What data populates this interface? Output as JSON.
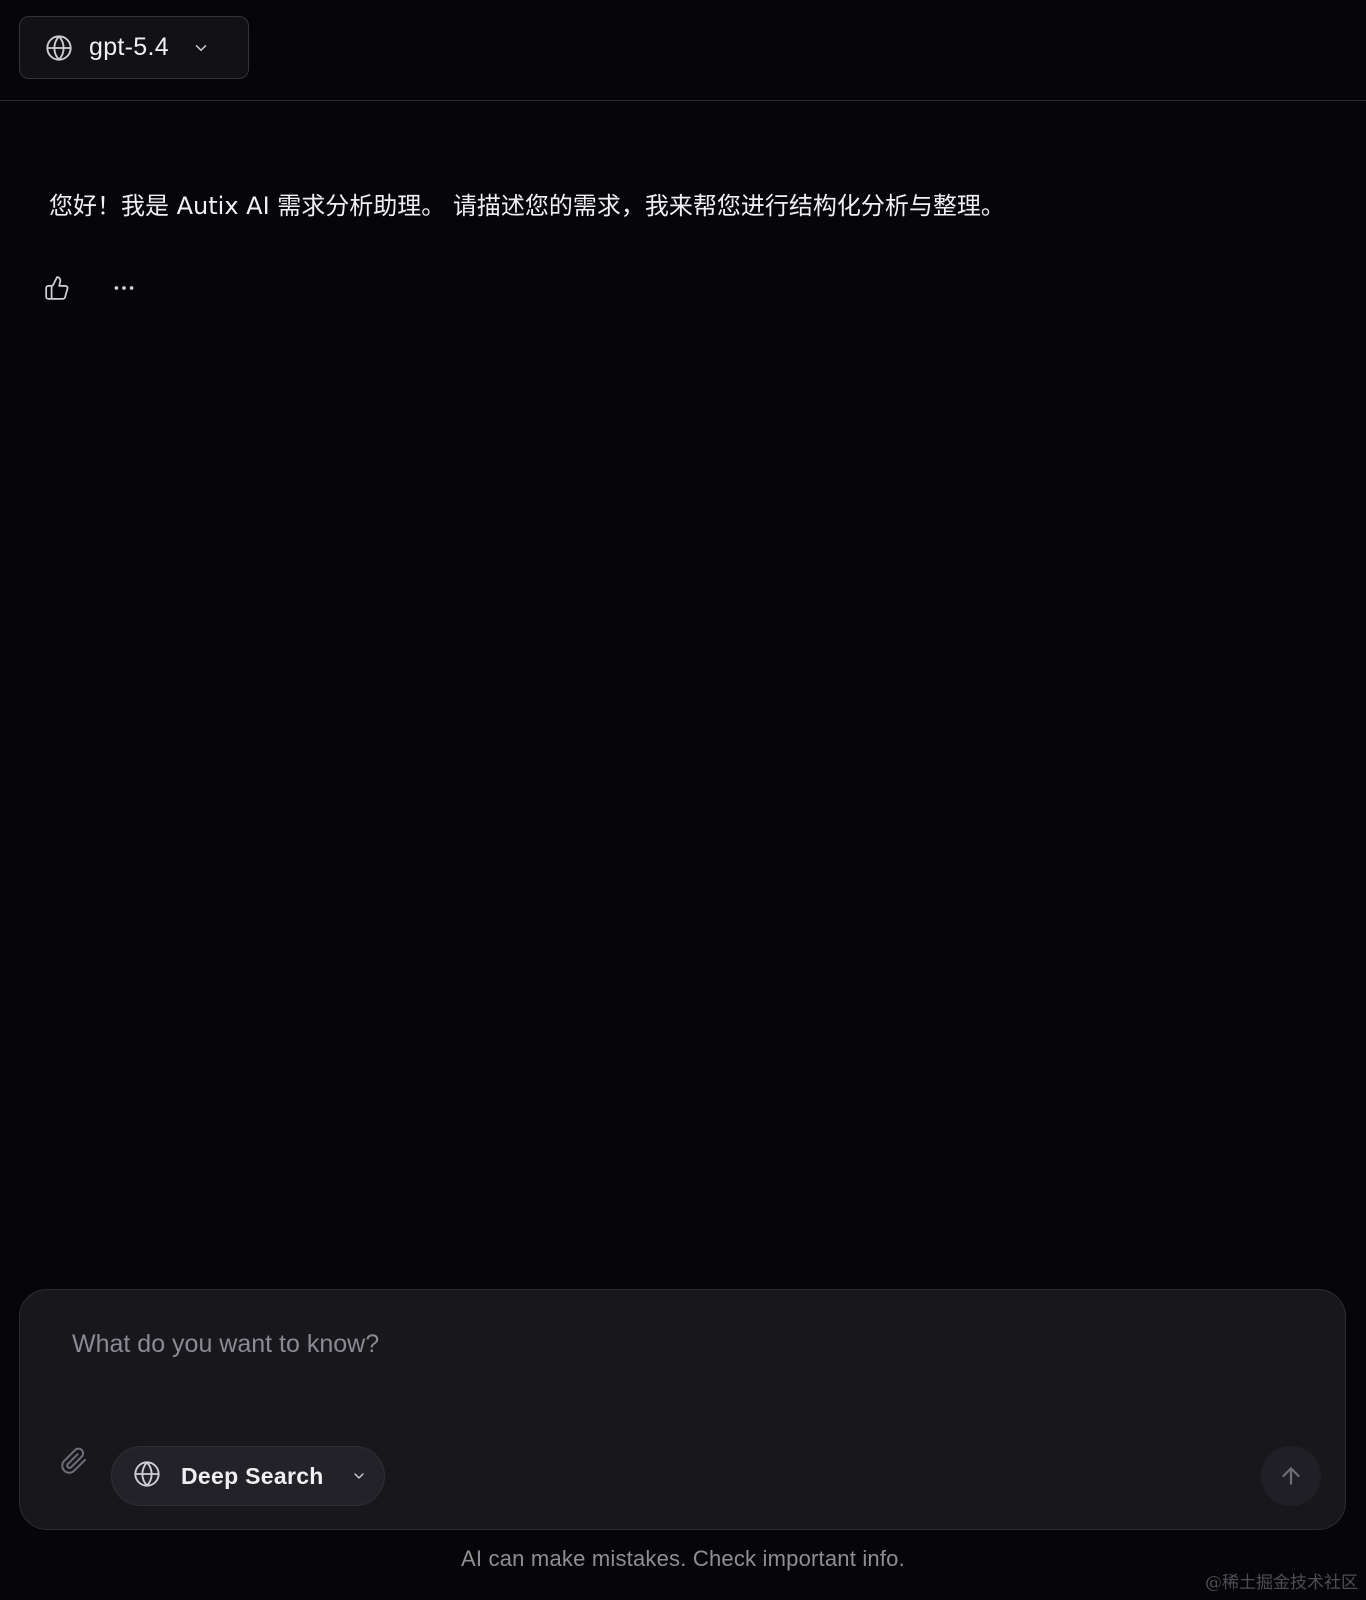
{
  "header": {
    "model_name": "gpt-5.4",
    "model_icon": "globe-icon",
    "model_chevron_icon": "chevron-down-icon"
  },
  "conversation": {
    "assistant_message": "您好！我是 Autix AI 需求分析助理。 请描述您的需求，我来帮您进行结构化分析与整理。",
    "actions": {
      "like_icon": "thumbs-up-icon",
      "more_icon": "more-horizontal-icon"
    }
  },
  "composer": {
    "placeholder": "What do you want to know?",
    "value": "",
    "attach_icon": "paperclip-icon",
    "search_mode": {
      "label": "Deep Search",
      "icon": "globe-icon",
      "chevron_icon": "chevron-down-icon"
    },
    "send_icon": "arrow-up-icon"
  },
  "footer": {
    "disclaimer": "AI can make mistakes. Check important info.",
    "watermark": "@稀土掘金技术社区"
  },
  "colors": {
    "background": "#060609",
    "surface": "#17171c",
    "border": "#2c2c33",
    "text_primary": "#ececf0",
    "text_muted": "#8a8a93"
  }
}
